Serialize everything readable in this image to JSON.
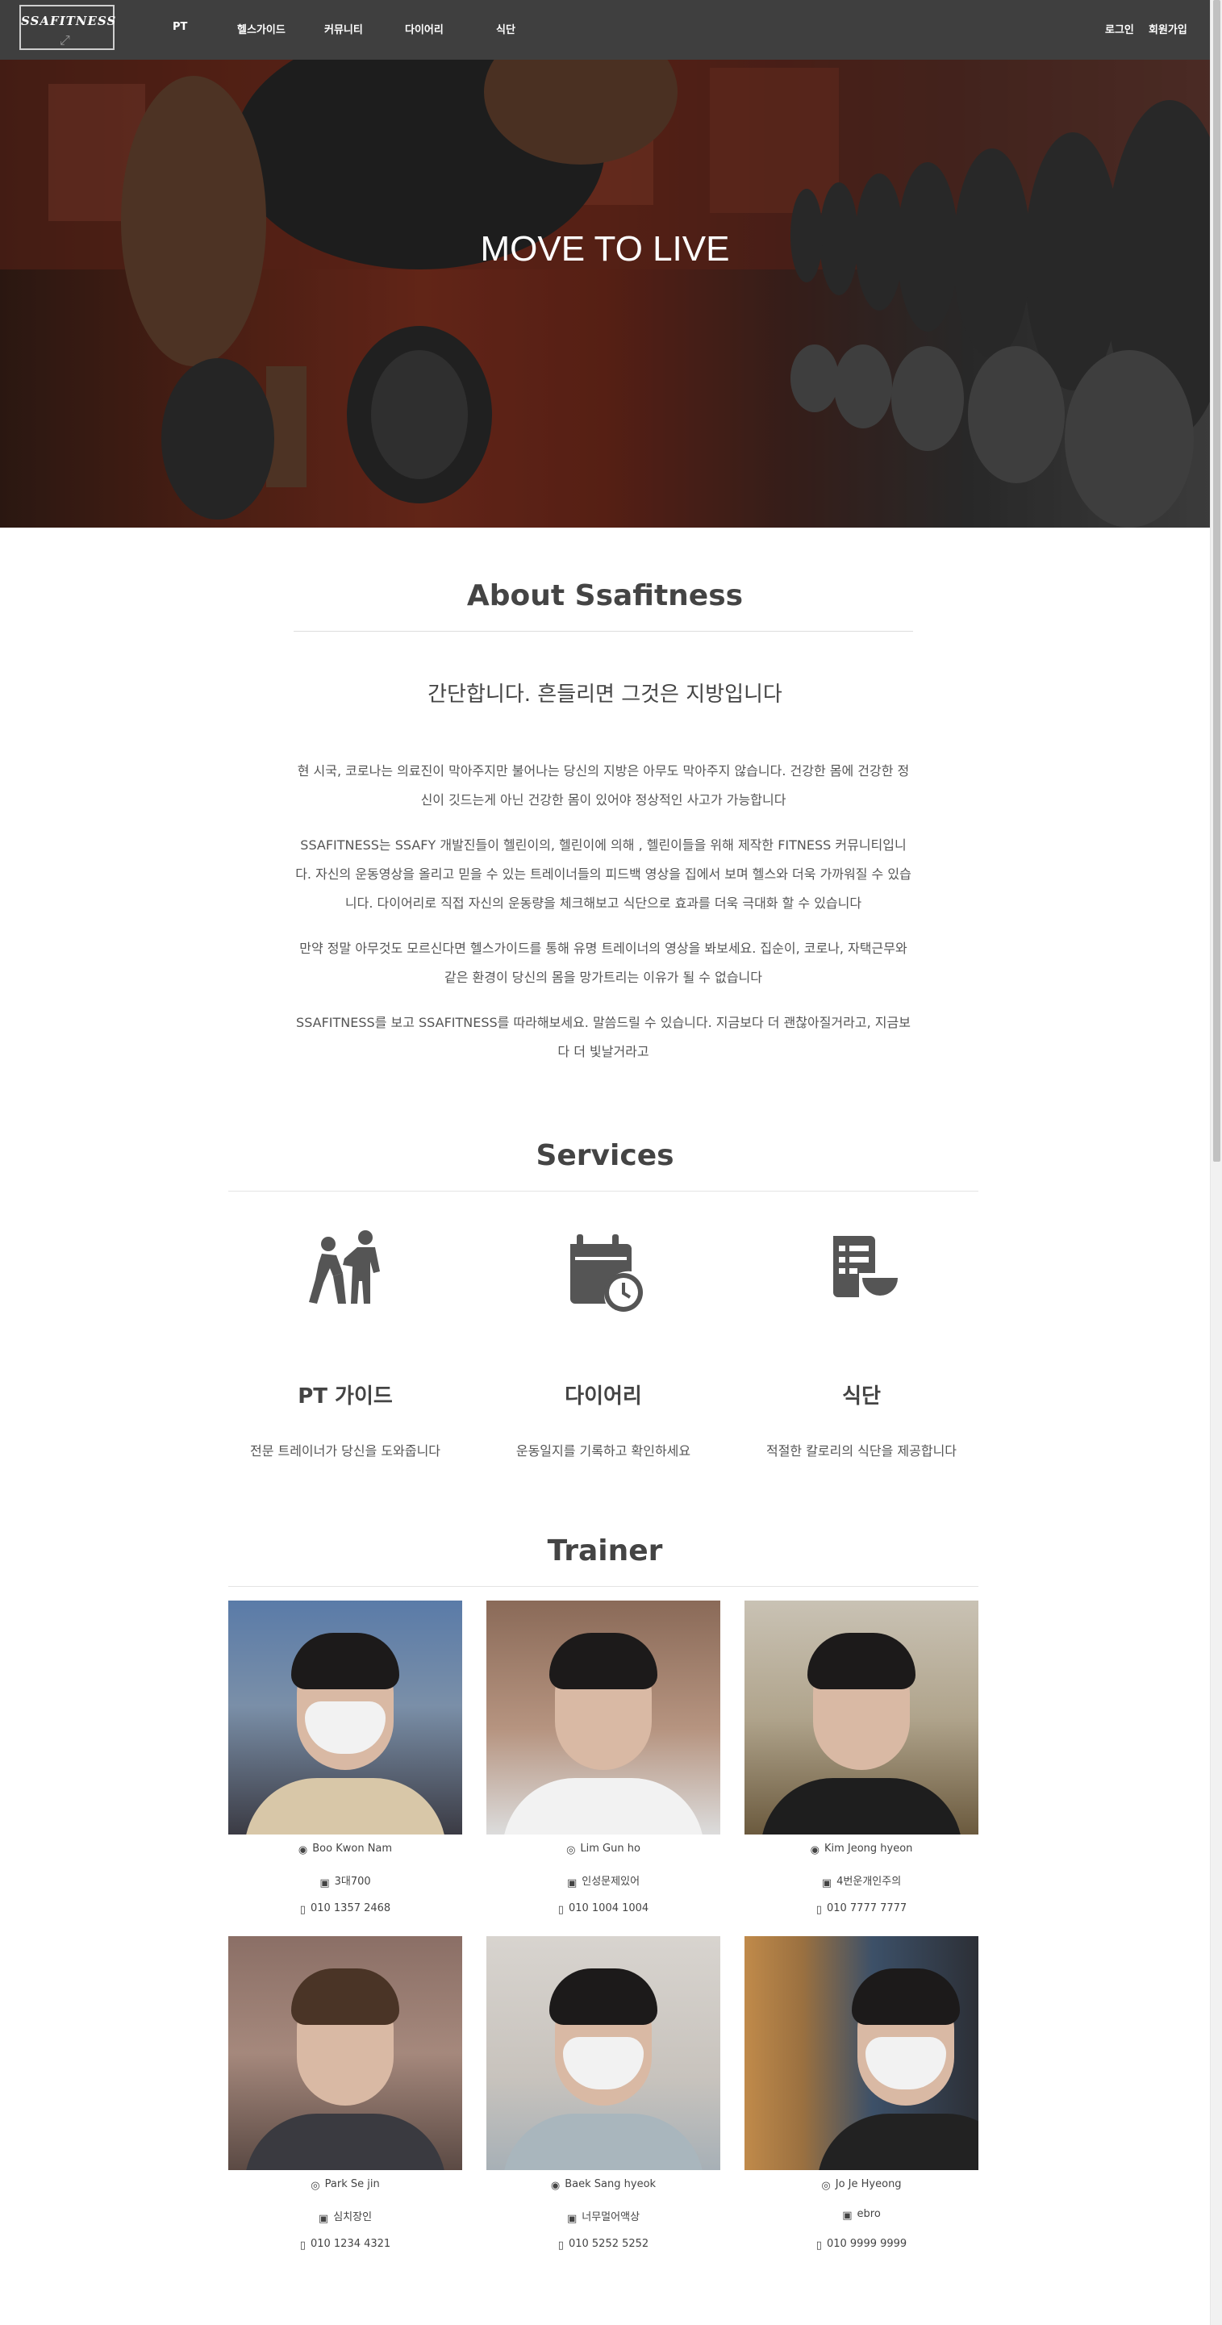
{
  "nav": {
    "logo_text": "SSAFITNESS",
    "links": [
      "PT",
      "헬스가이드",
      "커뮤니티",
      "다이어리",
      "식단"
    ],
    "login": "로그인",
    "signup": "회원가입"
  },
  "hero": {
    "title": "MOVE TO LIVE"
  },
  "about": {
    "title": "About Ssafitness",
    "subtitle": "간단합니다. 흔들리면 그것은 지방입니다",
    "paragraphs": [
      "현 시국, 코로나는 의료진이 막아주지만 불어나는 당신의 지방은 아무도 막아주지 않습니다. 건강한 몸에 건강한 정신이 깃드는게 아닌 건강한 몸이 있어야 정상적인 사고가 가능합니다",
      "SSAFITNESS는 SSAFY 개발진들이 헬린이의, 헬린이에 의해 , 헬린이들을 위해 제작한 FITNESS 커뮤니티입니다. 자신의 운동영상을 올리고 믿을 수 있는 트레이너들의 피드백 영상을 집에서 보며 헬스와 더욱 가까워질 수 있습니다. 다이어리로 직접 자신의 운동량을 체크해보고 식단으로 효과를 더욱 극대화 할 수 있습니다",
      "만약 정말 아무것도 모르신다면 헬스가이드를 통해 유명 트레이너의 영상을 봐보세요. 집순이, 코로나, 자택근무와 같은 환경이 당신의 몸을 망가트리는 이유가 될 수 없습니다",
      "SSAFITNESS를 보고 SSAFITNESS를 따라해보세요. 말씀드릴 수 있습니다. 지금보다 더 괜찮아질거라고, 지금보다 더 빛날거라고"
    ]
  },
  "services": {
    "title": "Services",
    "items": [
      {
        "icon": "trainer-assist-icon",
        "title": "PT 가이드",
        "desc": "전문 트레이너가 당신을 도와줍니다"
      },
      {
        "icon": "calendar-clock-icon",
        "title": "다이어리",
        "desc": "운동일지를 기록하고 확인하세요"
      },
      {
        "icon": "menu-bowl-icon",
        "title": "식단",
        "desc": "적절한 칼로리의 식단을 제공합니다"
      }
    ]
  },
  "trainer": {
    "title": "Trainer",
    "cards": [
      {
        "name": "Boo Kwon Nam",
        "tag": "3대700",
        "phone": "010 1357 2468"
      },
      {
        "name": "Lim Gun ho",
        "tag": "인성문제있어",
        "phone": "010 1004 1004"
      },
      {
        "name": "Kim Jeong hyeon",
        "tag": "4번운개인주의",
        "phone": "010 7777 7777"
      },
      {
        "name": "Park Se jin",
        "tag": "심치장인",
        "phone": "010 1234 4321"
      },
      {
        "name": "Baek Sang hyeok",
        "tag": "너무멀어액상",
        "phone": "010 5252 5252"
      },
      {
        "name": "Jo Je Hyeong",
        "tag": "ebro",
        "phone": "010 9999 9999"
      }
    ]
  },
  "colors": {
    "nav_bg": "#3f3f3f",
    "icon": "#555555",
    "heading": "#444444"
  }
}
